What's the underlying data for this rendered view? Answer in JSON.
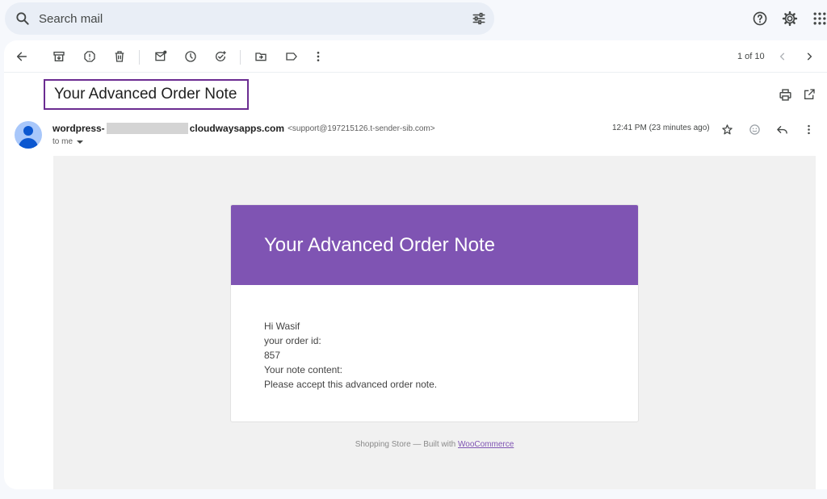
{
  "search": {
    "placeholder": "Search mail"
  },
  "toolbar": {
    "pager": "1 of 10"
  },
  "message": {
    "subject": "Your Advanced Order Note",
    "sender_prefix": "wordpress-",
    "sender_domain": "cloudwaysapps.com",
    "sender_email": "<support@197215126.t-sender-sib.com>",
    "to": "to me",
    "timestamp": "12:41 PM (23 minutes ago)"
  },
  "email": {
    "header_title": "Your Advanced Order Note",
    "header_color": "#7f54b3",
    "lines": [
      "Hi Wasif",
      "your order id:",
      "857",
      "Your note content:",
      "Please accept this advanced order note."
    ],
    "footer_text": "Shopping Store — Built with ",
    "footer_link": "WooCommerce"
  },
  "icons": {
    "top": [
      "help-icon",
      "settings-icon",
      "apps-icon"
    ],
    "toolbar": [
      "back-arrow-icon",
      "archive-icon",
      "report-spam-icon",
      "delete-icon",
      "mark-unread-icon",
      "snooze-icon",
      "add-task-icon",
      "move-to-icon",
      "label-icon",
      "more-icon",
      "prev-icon",
      "next-icon"
    ]
  }
}
